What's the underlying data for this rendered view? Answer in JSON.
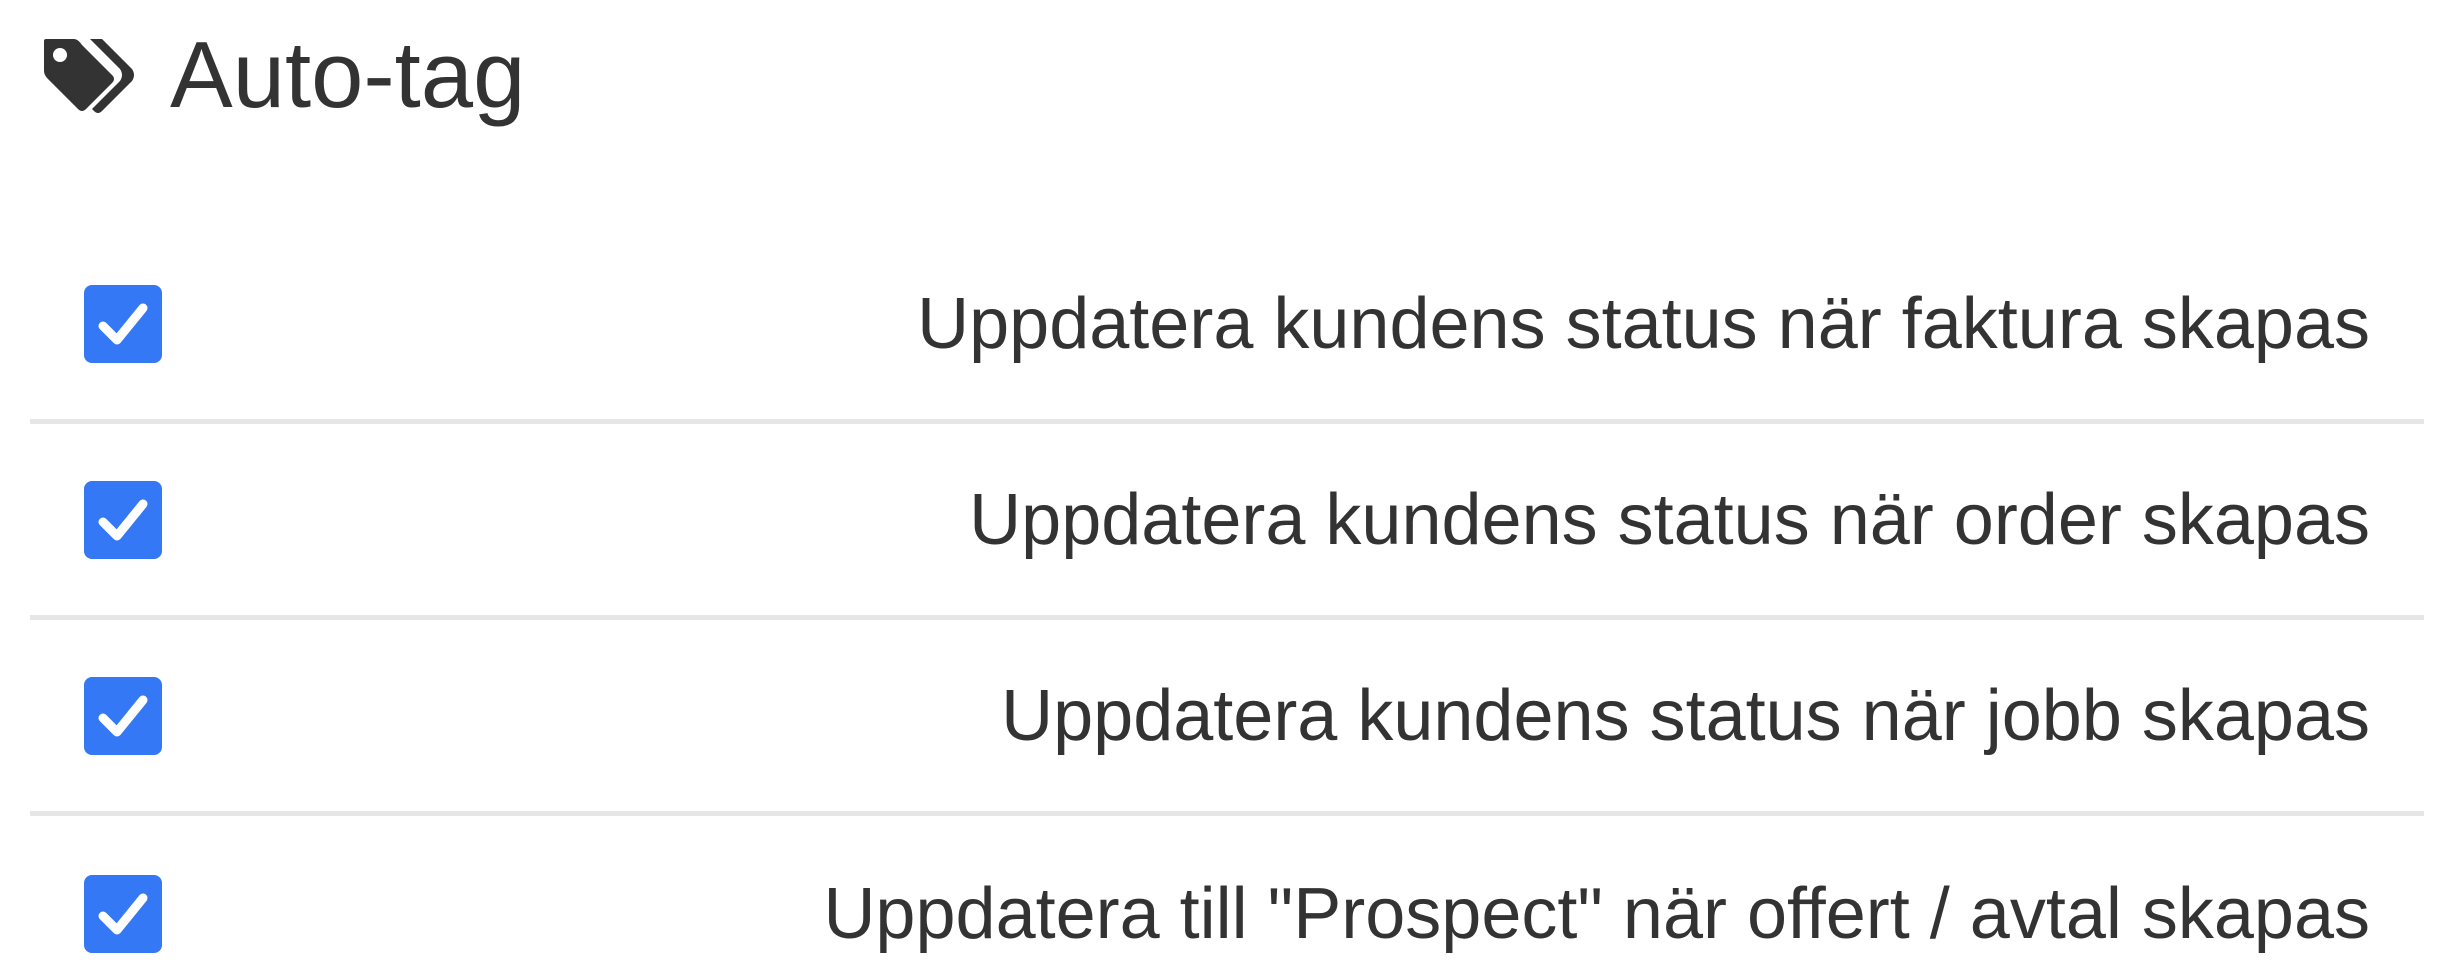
{
  "header": {
    "icon": "tags-icon",
    "title": "Auto-tag"
  },
  "colors": {
    "checkbox": "#3478f6",
    "text": "#333333",
    "divider": "#e6e6e6"
  },
  "options": [
    {
      "label": "Uppdatera kundens status när faktura skapas",
      "checked": true
    },
    {
      "label": "Uppdatera kundens status när order skapas",
      "checked": true
    },
    {
      "label": "Uppdatera kundens status när jobb skapas",
      "checked": true
    },
    {
      "label": "Uppdatera till \"Prospect\" när offert / avtal skapas",
      "checked": true
    }
  ]
}
